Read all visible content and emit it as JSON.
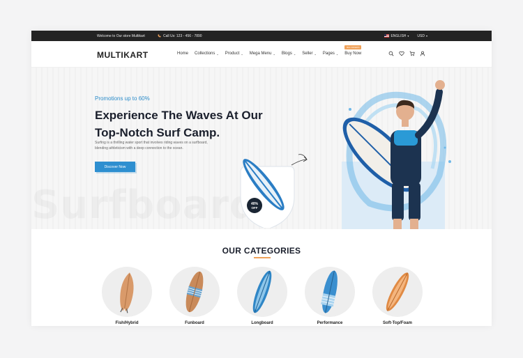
{
  "topbar": {
    "welcome": "Welcome to Our store Multikart",
    "call": "Call Us: 123 - 456 - 7890",
    "language": "ENGLISH",
    "currency": "USD"
  },
  "header": {
    "logo": "MULTIKART",
    "nav": [
      {
        "label": "Home"
      },
      {
        "label": "Collections"
      },
      {
        "label": "Product"
      },
      {
        "label": "Mega Menu"
      },
      {
        "label": "Blogs"
      },
      {
        "label": "Seller"
      },
      {
        "label": "Pages"
      },
      {
        "label": "Buy Now",
        "badge": "BIG OFFERS"
      }
    ]
  },
  "hero": {
    "promo": "Promotions up to 60%",
    "title_line1": "Experience The Waves At Our",
    "title_line2": "Top-Notch Surf Camp.",
    "desc_line1": "Surfing is a thrilling water sport that involves riding waves on a surfboard,",
    "desc_line2": "blending athleticism with a deep connection to the ocean.",
    "cta": "Discover Now",
    "discount_line1": "40%",
    "discount_line2": "OFF",
    "ghost_text": "Surfboard"
  },
  "categories": {
    "title": "OUR CATEGORIES",
    "items": [
      {
        "label": "Fish/Hybrid"
      },
      {
        "label": "Funboard"
      },
      {
        "label": "Longboard"
      },
      {
        "label": "Performance"
      },
      {
        "label": "Soft-Top/Foam"
      }
    ]
  },
  "colors": {
    "accent": "#2e8fd0",
    "highlight": "#f0a25a",
    "topbar": "#232323"
  }
}
